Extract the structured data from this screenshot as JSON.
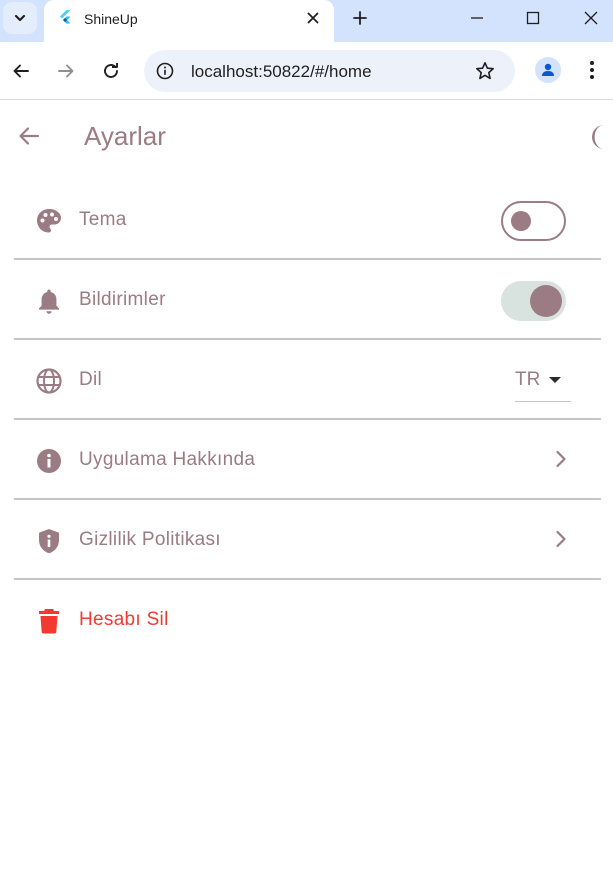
{
  "browser": {
    "tab_title": "ShineUp",
    "url": "localhost:50822/#/home",
    "icons": {
      "tab_search": "chevron-down-icon",
      "favicon": "flutter-icon",
      "tab_close": "close-icon",
      "new_tab": "plus-icon",
      "minimize": "minimize-icon",
      "maximize": "maximize-icon",
      "close_window": "close-icon",
      "back": "arrow-left-icon",
      "forward": "arrow-right-icon",
      "reload": "reload-icon",
      "site_info": "info-icon",
      "bookmark": "star-icon",
      "profile": "person-icon",
      "menu": "kebab-icon"
    }
  },
  "app": {
    "title": "Ayarlar",
    "accent_color": "#9b7b84",
    "danger_color": "#f23a30",
    "theme_toggle_icon": "moon-icon",
    "settings": [
      {
        "id": "theme",
        "label": "Tema",
        "icon": "palette-icon",
        "control": "switch",
        "on": false
      },
      {
        "id": "notifications",
        "label": "Bildirimler",
        "icon": "bell-icon",
        "control": "switch",
        "on": true
      },
      {
        "id": "language",
        "label": "Dil",
        "icon": "globe-icon",
        "control": "dropdown",
        "value": "TR"
      },
      {
        "id": "about",
        "label": "Uygulama Hakkında",
        "icon": "info-icon",
        "control": "chevron"
      },
      {
        "id": "privacy",
        "label": "Gizlilik Politikası",
        "icon": "shield-icon",
        "control": "chevron"
      },
      {
        "id": "delete_account",
        "label": "Hesabı Sil",
        "icon": "trash-icon",
        "control": "none"
      }
    ]
  }
}
